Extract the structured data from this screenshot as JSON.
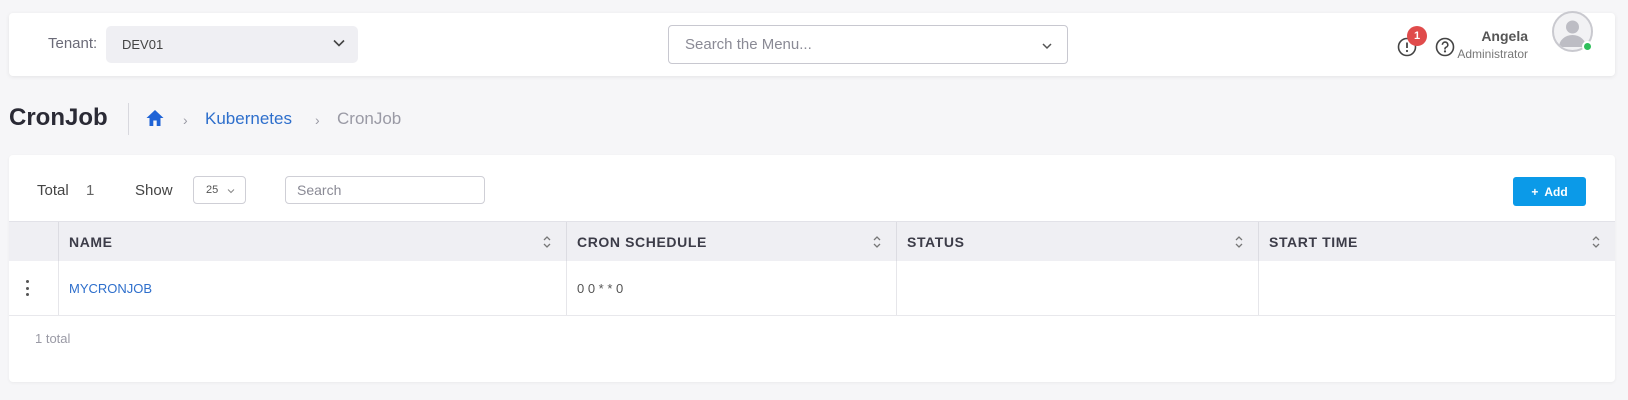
{
  "topbar": {
    "tenant_label": "Tenant:",
    "tenant_value": "DEV01",
    "menu_search_placeholder": "Search the Menu...",
    "notification_count": "1",
    "user_name": "Angela",
    "user_role": "Administrator"
  },
  "header": {
    "title": "CronJob",
    "breadcrumb": [
      "Kubernetes",
      "CronJob"
    ]
  },
  "toolbar": {
    "total_label": "Total",
    "total_value": "1",
    "show_label": "Show",
    "page_size": "25",
    "search_placeholder": "Search",
    "add_label": "Add"
  },
  "table": {
    "columns": [
      "NAME",
      "CRON SCHEDULE",
      "STATUS",
      "START TIME"
    ],
    "rows": [
      {
        "name": "MYCRONJOB",
        "schedule": "0 0 * * 0",
        "status": "",
        "start_time": ""
      }
    ]
  },
  "footer": {
    "total_text": "1 total"
  },
  "colors": {
    "accent": "#0b9ae8",
    "link": "#2e6fcc",
    "badge": "#e04b4b",
    "online": "#2fbf5b"
  },
  "icons": [
    "chevron-down-icon",
    "alert-icon",
    "help-icon",
    "user-icon",
    "home-icon",
    "sort-icon",
    "kebab-menu-icon",
    "plus-icon"
  ]
}
